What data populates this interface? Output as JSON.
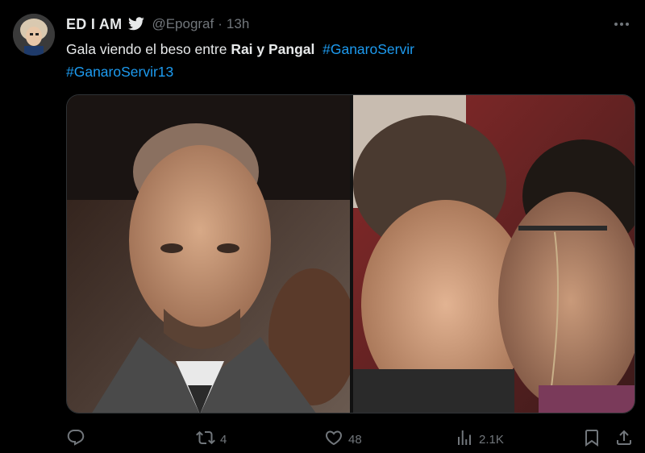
{
  "tweet": {
    "display_name": "ED I AM",
    "handle": "@Epograf",
    "separator": "·",
    "time": "13h",
    "text_prefix": "Gala viendo el beso entre ",
    "text_bold": "Rai y Pangal",
    "hashtag_1": "#GanaroServir",
    "hashtag_2": "#GanaroServir13"
  },
  "actions": {
    "replies": "",
    "retweets": "4",
    "likes": "48",
    "views": "2.1K"
  },
  "icons": {
    "verified": "bird-icon",
    "more": "more-icon",
    "reply": "reply-icon",
    "retweet": "retweet-icon",
    "like": "heart-icon",
    "views": "views-icon",
    "bookmark": "bookmark-icon",
    "share": "share-icon"
  },
  "colors": {
    "background": "#000000",
    "text": "#e7e9ea",
    "secondary": "#71767b",
    "accent": "#1d9bf0"
  }
}
